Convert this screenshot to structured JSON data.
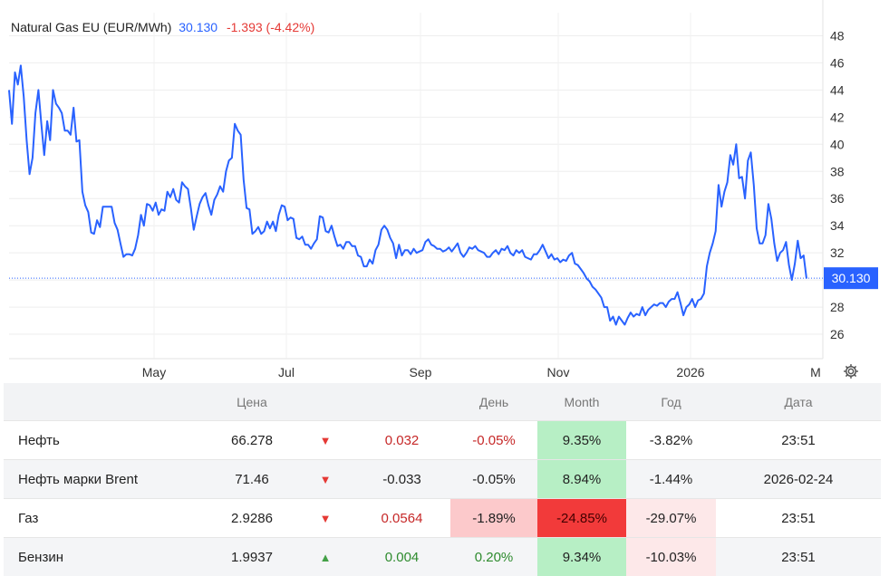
{
  "header": {
    "instrument": "Natural Gas EU (EUR/MWh)",
    "price": "30.130",
    "change": "-1.393 (-4.42%)"
  },
  "chart_data": {
    "type": "line",
    "title": "Natural Gas EU (EUR/MWh)",
    "x_tick_labels": [
      "May",
      "Jul",
      "Sep",
      "Nov",
      "2026",
      "M"
    ],
    "y_ticks": [
      26,
      28,
      30,
      32,
      34,
      36,
      38,
      40,
      42,
      44,
      46,
      48
    ],
    "ylim": [
      24.2,
      49.7
    ],
    "current_price_label": "30.130",
    "current_price_value": 30.13,
    "grid": true,
    "line_color": "#2962ff",
    "series": [
      {
        "values": [
          44.0,
          41.5,
          45.3,
          44.4,
          45.8,
          43.5,
          40.3,
          37.8,
          39.0,
          42.3,
          44.0,
          41.5,
          39.2,
          41.7,
          40.3,
          44.0,
          43.0,
          42.7,
          42.3,
          41.0,
          41.0,
          40.7,
          42.7,
          40.2,
          40.3,
          36.5,
          35.5,
          35.0,
          33.5,
          33.4,
          34.4,
          33.9,
          35.4,
          35.4,
          35.4,
          35.4,
          34.2,
          33.7,
          32.7,
          31.7,
          31.9,
          31.9,
          31.8,
          32.3,
          33.3,
          34.8,
          34.0,
          35.6,
          35.5,
          35.1,
          35.7,
          34.8,
          35.2,
          35.1,
          36.5,
          36.1,
          36.7,
          35.9,
          35.7,
          37.2,
          36.9,
          36.7,
          35.3,
          33.7,
          34.7,
          35.6,
          36.1,
          36.4,
          35.5,
          34.8,
          35.9,
          36.3,
          36.9,
          36.5,
          38.0,
          38.8,
          39.0,
          41.5,
          41.0,
          40.7,
          37.4,
          35.3,
          35.2,
          33.4,
          33.6,
          33.9,
          33.4,
          33.6,
          34.3,
          33.8,
          34.3,
          33.6,
          34.8,
          35.5,
          35.4,
          34.4,
          34.6,
          34.5,
          33.1,
          33.0,
          33.2,
          32.6,
          32.6,
          32.3,
          32.7,
          33.0,
          34.7,
          34.6,
          33.6,
          33.5,
          34.0,
          33.2,
          32.5,
          32.6,
          32.3,
          32.8,
          32.8,
          32.5,
          32.5,
          31.8,
          31.7,
          31.0,
          31.0,
          31.5,
          31.2,
          32.2,
          32.6,
          33.7,
          34.0,
          33.7,
          33.1,
          32.7,
          31.6,
          32.6,
          31.8,
          32.2,
          32.2,
          31.9,
          32.3,
          32.0,
          32.1,
          32.2,
          32.8,
          33.0,
          32.6,
          32.5,
          32.3,
          32.3,
          32.1,
          32.2,
          32.4,
          32.1,
          32.4,
          32.7,
          32.0,
          31.7,
          32.0,
          32.4,
          32.3,
          32.5,
          32.2,
          32.1,
          32.0,
          31.7,
          31.7,
          32.0,
          32.2,
          31.9,
          32.3,
          32.2,
          32.5,
          32.0,
          31.8,
          32.2,
          32.0,
          32.2,
          31.7,
          31.6,
          31.5,
          31.9,
          31.9,
          32.2,
          32.6,
          32.1,
          31.6,
          31.9,
          31.5,
          31.6,
          31.3,
          31.5,
          31.4,
          31.8,
          32.0,
          31.2,
          31.1,
          30.8,
          30.5,
          30.1,
          29.9,
          29.5,
          29.3,
          29.0,
          28.7,
          28.0,
          28.0,
          27.0,
          27.3,
          26.7,
          27.3,
          27.0,
          26.7,
          27.2,
          27.6,
          27.3,
          27.5,
          27.4,
          28.0,
          27.4,
          27.8,
          28.0,
          28.2,
          28.1,
          28.3,
          28.3,
          28.0,
          28.4,
          28.6,
          28.6,
          29.1,
          28.3,
          27.4,
          28.0,
          28.2,
          28.6,
          28.0,
          28.5,
          28.6,
          29.0,
          31.0,
          32.0,
          32.7,
          33.6,
          37.0,
          35.4,
          36.5,
          37.2,
          39.2,
          38.5,
          40.0,
          37.5,
          37.6,
          36.0,
          38.8,
          39.4,
          37.0,
          33.8,
          32.7,
          32.7,
          33.3,
          35.6,
          34.5,
          32.7,
          31.4,
          32.0,
          32.2,
          32.8,
          31.1,
          30.0,
          31.2,
          32.9,
          31.6,
          31.8,
          30.1
        ]
      }
    ]
  },
  "table": {
    "headers": [
      "",
      "Цена",
      "",
      "",
      "День",
      "Month",
      "Год",
      "Дата"
    ],
    "rows": [
      {
        "name": "Нефть",
        "price": "66.278",
        "dir": "down",
        "change": "0.032",
        "day": "-0.05%",
        "month": "9.35%",
        "year": "-3.82%",
        "date": "23:51"
      },
      {
        "name": "Нефть марки Brent",
        "price": "71.46",
        "dir": "down",
        "change": "-0.033",
        "day": "-0.05%",
        "month": "8.94%",
        "year": "-1.44%",
        "date": "2026-02-24"
      },
      {
        "name": "Газ",
        "price": "2.9286",
        "dir": "down",
        "change": "0.0564",
        "day": "-1.89%",
        "month": "-24.85%",
        "year": "-29.07%",
        "date": "23:51"
      },
      {
        "name": "Бензин",
        "price": "1.9937",
        "dir": "up",
        "change": "0.004",
        "day": "0.20%",
        "month": "9.34%",
        "year": "-10.03%",
        "date": "23:51"
      }
    ]
  },
  "icons": {
    "settings": "gear-icon",
    "down": "triangle-down-icon",
    "up": "triangle-up-icon"
  },
  "colors": {
    "line": "#2962ff",
    "negative": "#e53935",
    "positive": "#2e8b2e",
    "price_tag_bg": "#2962ff"
  }
}
